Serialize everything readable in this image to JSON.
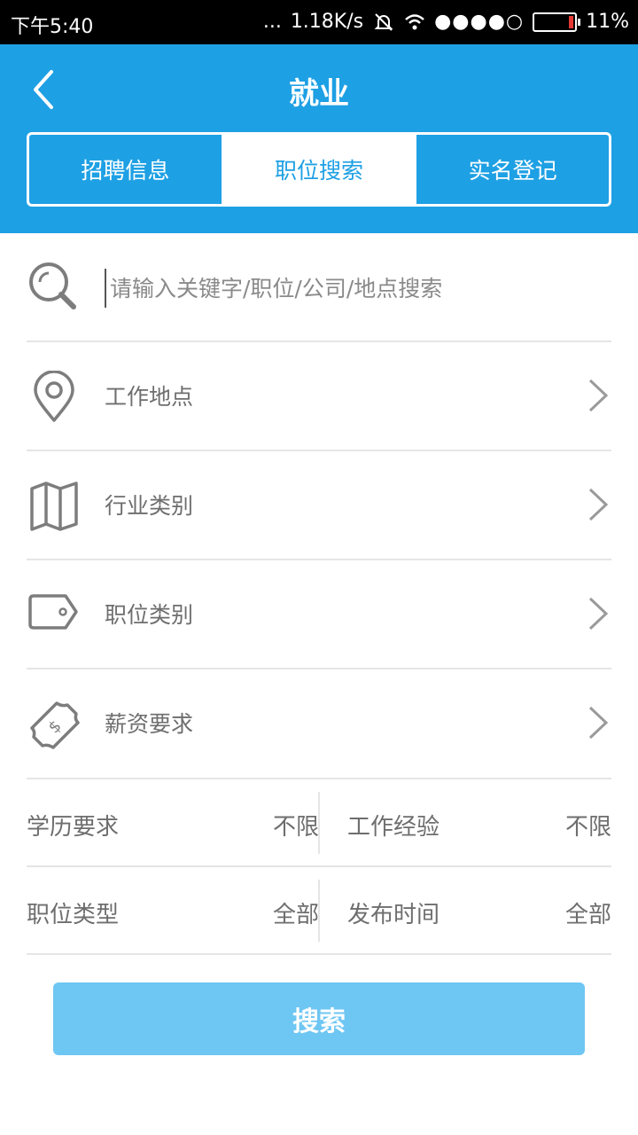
{
  "status_bar": {
    "time": "下午5:40",
    "dots": "...",
    "speed": "1.18K/s",
    "signal": "●●●●○",
    "battery": "11%"
  },
  "header": {
    "title": "就业",
    "back_icon": "chevron-left-icon",
    "tabs": [
      {
        "label": "招聘信息",
        "active": false
      },
      {
        "label": "职位搜索",
        "active": true
      },
      {
        "label": "实名登记",
        "active": false
      }
    ],
    "accent_color": "#1ea0e4"
  },
  "search": {
    "placeholder": "请输入关键字/职位/公司/地点搜索",
    "icon": "search-icon"
  },
  "nav_items": [
    {
      "label": "工作地点",
      "icon": "location-pin-icon"
    },
    {
      "label": "行业类别",
      "icon": "map-icon"
    },
    {
      "label": "职位类别",
      "icon": "tag-icon"
    },
    {
      "label": "薪资要求",
      "icon": "money-bill-icon"
    }
  ],
  "filters": [
    {
      "left": {
        "key": "学历要求",
        "value": "不限"
      },
      "right": {
        "key": "工作经验",
        "value": "不限"
      }
    },
    {
      "left": {
        "key": "职位类型",
        "value": "全部"
      },
      "right": {
        "key": "发布时间",
        "value": "全部"
      }
    }
  ],
  "search_button": {
    "label": "搜索",
    "color": "#6ec6f3"
  }
}
